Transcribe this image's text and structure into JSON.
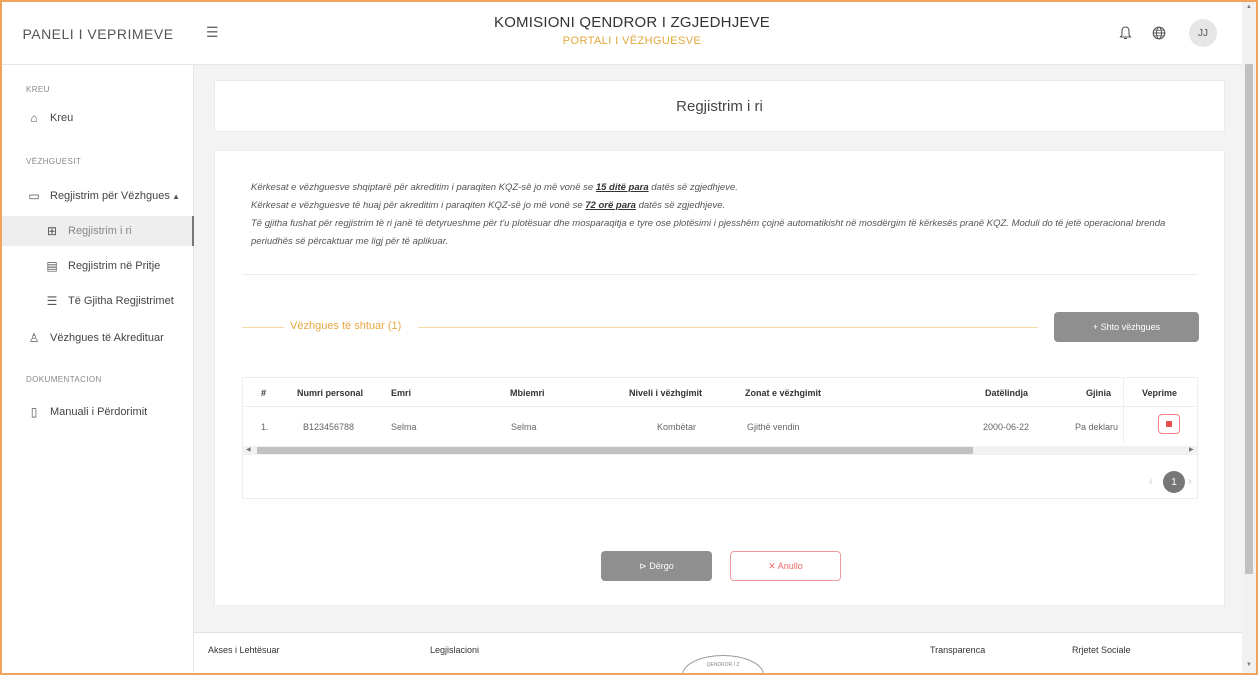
{
  "header": {
    "brand": "PANELI I VEPRIMEVE",
    "title": "KOMISIONI QENDROR I ZGJEDHJEVE",
    "subtitle": "PORTALI I VËZHGUESVE",
    "avatar_initials": "JJ",
    "icons": [
      "menu-icon",
      "bell-icon",
      "globe-icon"
    ]
  },
  "sidebar": {
    "sections": [
      {
        "label": "KREU"
      },
      {
        "label": "VËZHGUESIT"
      },
      {
        "label": "DOKUMENTACION"
      }
    ],
    "items": [
      {
        "label": "Kreu",
        "icon": "home-icon"
      },
      {
        "label": "Regjistrim për Vëzhgues",
        "icon": "folder-icon"
      },
      {
        "label": "Regjistrim i ri",
        "icon": "grid-icon"
      },
      {
        "label": "Regjistrim në Pritje",
        "icon": "doc-icon"
      },
      {
        "label": "Të Gjitha Regjistrimet",
        "icon": "list-icon"
      },
      {
        "label": "Vëzhgues të Akredituar",
        "icon": "users-icon"
      },
      {
        "label": "Manuali i Përdorimit",
        "icon": "file-icon"
      }
    ]
  },
  "page": {
    "title": "Regjistrim i ri",
    "notes": {
      "line1_pre": "Kërkesat e vëzhguesve shqiptarë për akreditim i paraqiten KQZ-së jo më vonë se ",
      "line1_bold": "15 ditë para",
      "line1_post": " datës së zgjedhjeve.",
      "line2_pre": "Kërkesat e vëzhguesve të huaj për akreditim i paraqiten KQZ-së jo më vonë se ",
      "line2_bold": "72 orë para",
      "line2_post": " datës së zgjedhjeve.",
      "line3": "Të gjitha fushat për regjistrim të ri janë të detyrueshme për t'u plotësuar dhe mosparaqitja e tyre ose plotësimi i pjesshëm çojnë automatikisht në mosdërgim të kërkesës pranë KQZ. Moduli do të jetë operacional brenda periudhës së përcaktuar me ligj për të aplikuar."
    },
    "section_title": "Vëzhgues të shtuar (1)",
    "add_button": "+ Shto vëzhgues",
    "table": {
      "headers": [
        "#",
        "Numri personal",
        "Emri",
        "Mbiemri",
        "Niveli i vëzhgimit",
        "Zonat e vëzhgimit",
        "Datëlindja",
        "Gjinia",
        "Veprime"
      ],
      "rows": [
        [
          "1.",
          "B123456788",
          "Selma",
          "Selma",
          "Kombëtar",
          "Gjithë vendin",
          "2000-06-22",
          "Pa deklaru"
        ]
      ]
    },
    "pagination": {
      "current": "1"
    },
    "send_button": "⊳ Dërgo",
    "cancel_button": "✕ Anullo"
  },
  "footer": {
    "col1": "Akses i Lehtësuar",
    "col2": "Legjislacioni",
    "col3": "Transparenca",
    "col4": "Rrjetet Sociale",
    "seal_text": "QENDROR I Z"
  }
}
